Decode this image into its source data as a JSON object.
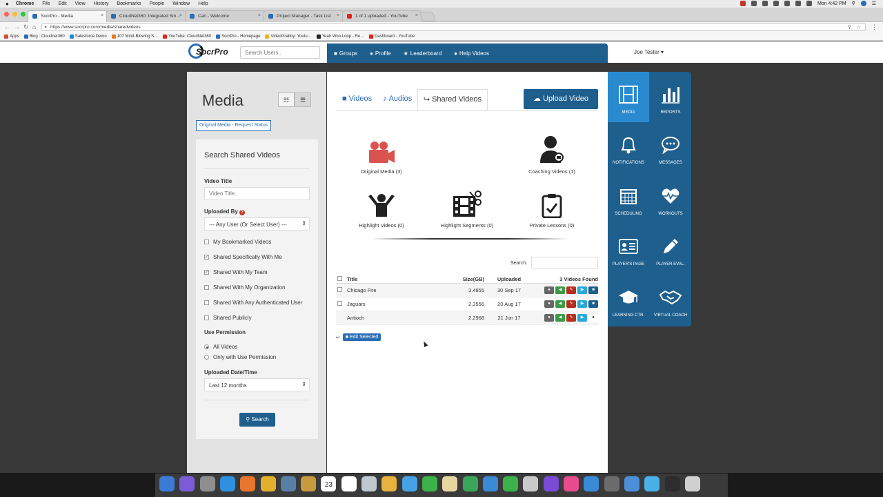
{
  "menubar": {
    "app": "Chrome",
    "items": [
      "File",
      "Edit",
      "View",
      "History",
      "Bookmarks",
      "People",
      "Window",
      "Help"
    ],
    "clock": "Mon 4:42 PM"
  },
  "tabs": [
    {
      "label": "SocrPro - Media",
      "color": "#2a6db5"
    },
    {
      "label": "CloudNet360: Integrated Sm…",
      "color": "#2a6db5"
    },
    {
      "label": "Cart - Welcome",
      "color": "#3b7bbf"
    },
    {
      "label": "Project Manager - Task List",
      "color": "#2a6db5"
    },
    {
      "label": "1 of 1 uploaded - YouTube",
      "color": "#e62117"
    }
  ],
  "address": {
    "url": "https://www.socrpro.com/media/sharedvideos"
  },
  "bookmarks": [
    {
      "label": "Apps",
      "color": "#d24b3a"
    },
    {
      "label": "Blog : Cloudnet360",
      "color": "#2a6db5"
    },
    {
      "label": "Salesforce Demo",
      "color": "#1b8bd8"
    },
    {
      "label": "107 Mind-Blowing S…",
      "color": "#e57e22"
    },
    {
      "label": "YouTube: CloudNet360",
      "color": "#e62117"
    },
    {
      "label": "SocrPro - Homepage",
      "color": "#2a6db5"
    },
    {
      "label": "VideoGrabby: Youtu…",
      "color": "#e6b422"
    },
    {
      "label": "Yeah Woo Loop - Re…",
      "color": "#222222"
    },
    {
      "label": "Dashboard - YouTube",
      "color": "#e62117"
    }
  ],
  "header": {
    "logo_text": "SocrPro",
    "user_search_placeholder": "Search Users..",
    "nav": [
      {
        "label": "Groups",
        "icon": "■"
      },
      {
        "label": "Profile",
        "icon": "●"
      },
      {
        "label": "Leaderboard",
        "icon": "★"
      },
      {
        "label": "Help Videos",
        "icon": "●"
      }
    ],
    "user": "Joe Tester ▾"
  },
  "left": {
    "title": "Media",
    "grid_icon": "☷",
    "list_icon": "☰",
    "status_button": "Original Media - Request Status",
    "search_title": "Search Shared Videos",
    "video_title_label": "Video Title",
    "video_title_placeholder": "Video Title..",
    "uploaded_by_label": "Uploaded By",
    "uploaded_by_value": "--- Any User (Or Select User) ---",
    "checkboxes": [
      {
        "label": "My Bookmarked Videos",
        "checked": false
      },
      {
        "label": "Shared Specifically With Me",
        "checked": true
      },
      {
        "label": "Shared With My Team",
        "checked": true
      },
      {
        "label": "Shared With My Organization",
        "checked": false
      },
      {
        "label": "Shared With Any Authenticated User",
        "checked": false
      },
      {
        "label": "Shared Publicly",
        "checked": false
      }
    ],
    "use_permission_label": "Use Permission",
    "radios": [
      {
        "label": "All Videos",
        "checked": true
      },
      {
        "label": "Only with Use Permission",
        "checked": false
      }
    ],
    "date_label": "Uploaded Date/Time",
    "date_value": "Last 12 months",
    "search_button": "Search"
  },
  "main": {
    "tabs": [
      {
        "label": "Videos",
        "icon": "■"
      },
      {
        "label": "Audios",
        "icon": "♪"
      },
      {
        "label": "Shared Videos",
        "icon": "⮡"
      }
    ],
    "upload_button": "Upload Video",
    "categories": [
      {
        "label": "Original Media (3)",
        "icon": "■"
      },
      {
        "label": "Coaching Videos (1)",
        "icon": "●"
      },
      {
        "label": "Highlight Videos (0)",
        "icon": "●"
      },
      {
        "label": "Highlight Segments (0)",
        "icon": "▦"
      },
      {
        "label": "Private Lessons (0)",
        "icon": "▤"
      }
    ],
    "table_search_label": "Search:",
    "columns": [
      "Title",
      "Size(GB)",
      "Uploaded",
      "3 Videos Found"
    ],
    "rows": [
      {
        "title": "Chicago Fire",
        "size": "3.4855",
        "uploaded": "30 Sep 17"
      },
      {
        "title": "Jaguars",
        "size": "2.3556",
        "uploaded": "20 Aug 17"
      },
      {
        "title": "Antioch",
        "size": "2.2968",
        "uploaded": "21 Jun 17"
      }
    ],
    "edit_selected": "Edit Selected"
  },
  "right_nav": [
    {
      "label": "MEDIA"
    },
    {
      "label": "REPORTS"
    },
    {
      "label": "NOTIFICATIONS"
    },
    {
      "label": "MESSAGES"
    },
    {
      "label": "SCHEDULING"
    },
    {
      "label": "WORKOUTS"
    },
    {
      "label": "PLAYER'S PAGE"
    },
    {
      "label": "PLAYER EVAL."
    },
    {
      "label": "LEARNING CTR."
    },
    {
      "label": "VIRTUAL COACH"
    }
  ],
  "dock": {
    "calendar_day": "23",
    "apps": [
      "#3a7bd5",
      "#7b5bd6",
      "#8e8e8e",
      "#2f90e0",
      "#e8762c",
      "#e2b02a",
      "#5a7fa6",
      "#c99a3d",
      "#e44c3b",
      "#ffffff",
      "#bfc7cf",
      "#e8b23f",
      "#45a3e5",
      "#3bb34a",
      "#e8d6a0",
      "#3ba55c",
      "#3a8ad8",
      "#3bb34a",
      "#c9c9c9",
      "#7b4bd6",
      "#e84c8e",
      "#3a8ad8",
      "#6c6c6c",
      "#4a8fd8",
      "#4ab0e8",
      "#2d2d2d",
      "#d0d0d0"
    ]
  }
}
